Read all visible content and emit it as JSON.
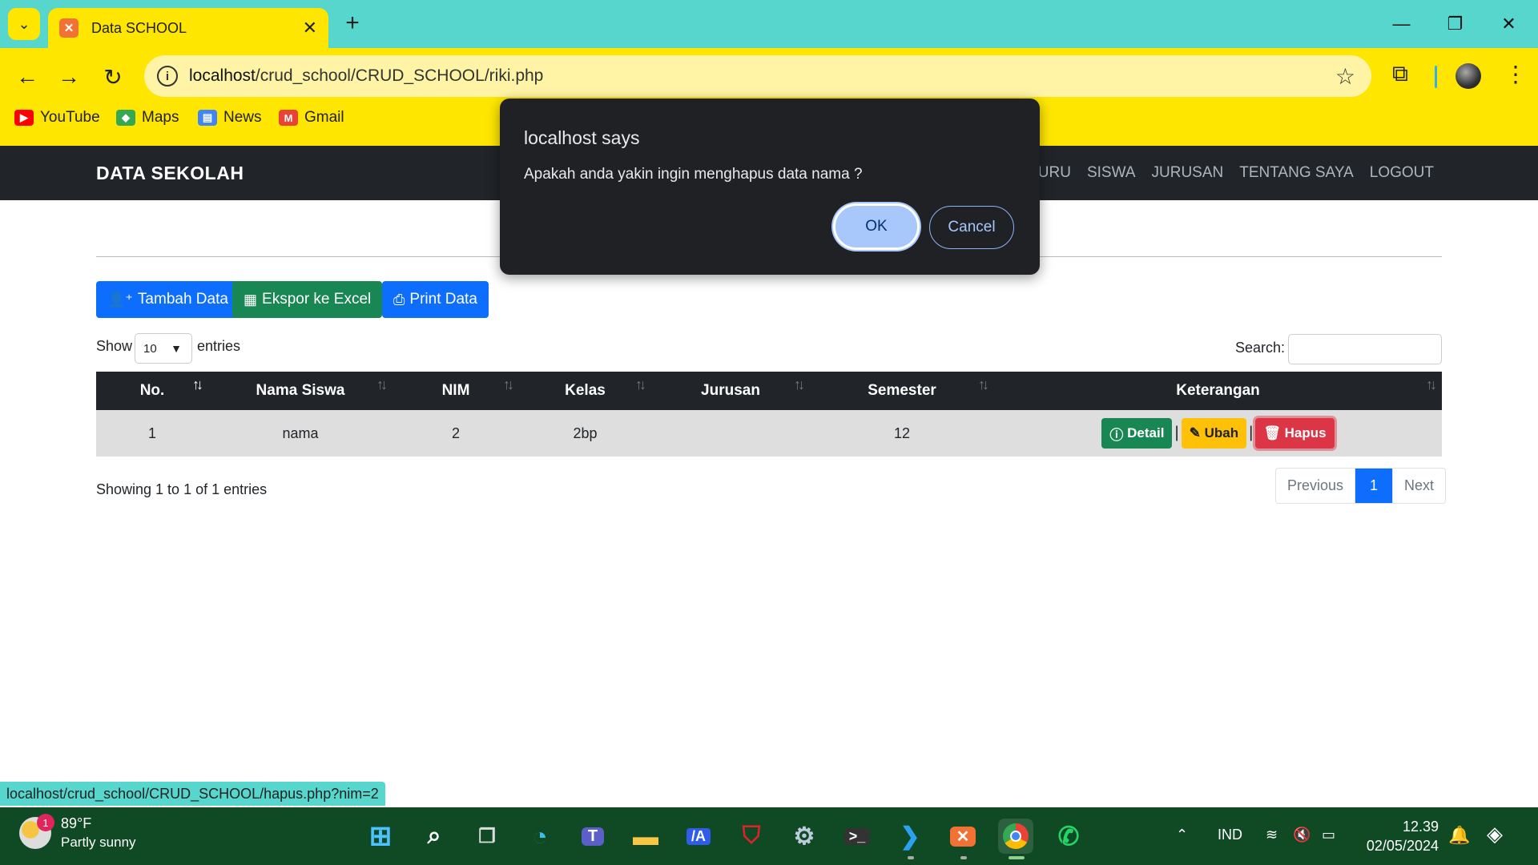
{
  "browser": {
    "tab_title": "Data SCHOOL",
    "url_host": "localhost",
    "url_path": "/crud_school/CRUD_SCHOOL/riki.php",
    "bookmarks": [
      "YouTube",
      "Maps",
      "News",
      "Gmail"
    ],
    "status_url": "localhost/crud_school/CRUD_SCHOOL/hapus.php?nim=2"
  },
  "navbar": {
    "brand": "DATA SEKOLAH",
    "menu": [
      "GURU",
      "SISWA",
      "JURUSAN",
      "TENTANG SAYA",
      "LOGOUT"
    ]
  },
  "actions": {
    "add": "Tambah Data",
    "export": "Ekspor ke Excel",
    "print": "Print Data"
  },
  "table_controls": {
    "show_label": "Show",
    "page_size": "10",
    "entries_label": "entries",
    "search_label": "Search:",
    "search_value": ""
  },
  "table": {
    "headers": [
      "No.",
      "Nama Siswa",
      "NIM",
      "Kelas",
      "Jurusan",
      "Semester",
      "Keterangan"
    ],
    "rows": [
      {
        "no": "1",
        "nama": "nama",
        "nim": "2",
        "kelas": "2bp",
        "jurusan": "",
        "semester": "12"
      }
    ],
    "row_actions": {
      "detail": "Detail",
      "ubah": "Ubah",
      "hapus": "Hapus",
      "separator": "|"
    }
  },
  "footer": {
    "showing": "Showing 1 to 1 of 1 entries",
    "previous": "Previous",
    "current_page": "1",
    "next": "Next"
  },
  "dialog": {
    "title": "localhost says",
    "message": "Apakah anda yakin ingin menghapus data nama ?",
    "ok": "OK",
    "cancel": "Cancel"
  },
  "taskbar": {
    "temp": "89°F",
    "weather": "Partly sunny",
    "weather_badge": "1",
    "lang": "IND",
    "time": "12.39",
    "date": "02/05/2024"
  },
  "colors": {
    "chrome_accent": "#56d6cc",
    "toolbar": "#ffe600",
    "navbar": "#212529",
    "primary": "#0d6efd",
    "success": "#198754",
    "warning": "#ffc107",
    "danger": "#dc3545",
    "taskbar": "#0f4a25"
  }
}
